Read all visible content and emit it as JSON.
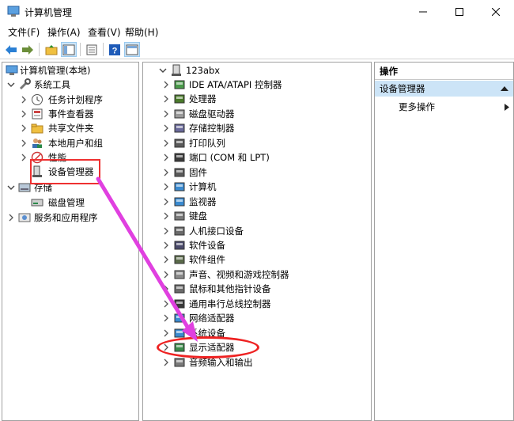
{
  "window": {
    "title": "计算机管理"
  },
  "menu": [
    "文件(F)",
    "操作(A)",
    "查看(V)",
    "帮助(H)"
  ],
  "left_tree": {
    "root": "计算机管理(本地)",
    "system_tools": "系统工具",
    "system_children": [
      "任务计划程序",
      "事件查看器",
      "共享文件夹",
      "本地用户和组",
      "性能",
      "设备管理器"
    ],
    "storage": "存储",
    "storage_children": [
      "磁盘管理"
    ],
    "services": "服务和应用程序"
  },
  "device_tree": {
    "computer": "123abx",
    "categories": [
      "IDE ATA/ATAPI 控制器",
      "处理器",
      "磁盘驱动器",
      "存储控制器",
      "打印队列",
      "端口 (COM 和 LPT)",
      "固件",
      "计算机",
      "监视器",
      "键盘",
      "人机接口设备",
      "软件设备",
      "软件组件",
      "声音、视频和游戏控制器",
      "鼠标和其他指针设备",
      "通用串行总线控制器",
      "网络适配器",
      "系统设备",
      "显示适配器",
      "音频输入和输出"
    ]
  },
  "actions": {
    "header": "操作",
    "section": "设备管理器",
    "more": "更多操作"
  },
  "colors": {
    "accent": "#cce4f7",
    "highlight": "#ee2222",
    "arrow": "#e040e0"
  }
}
